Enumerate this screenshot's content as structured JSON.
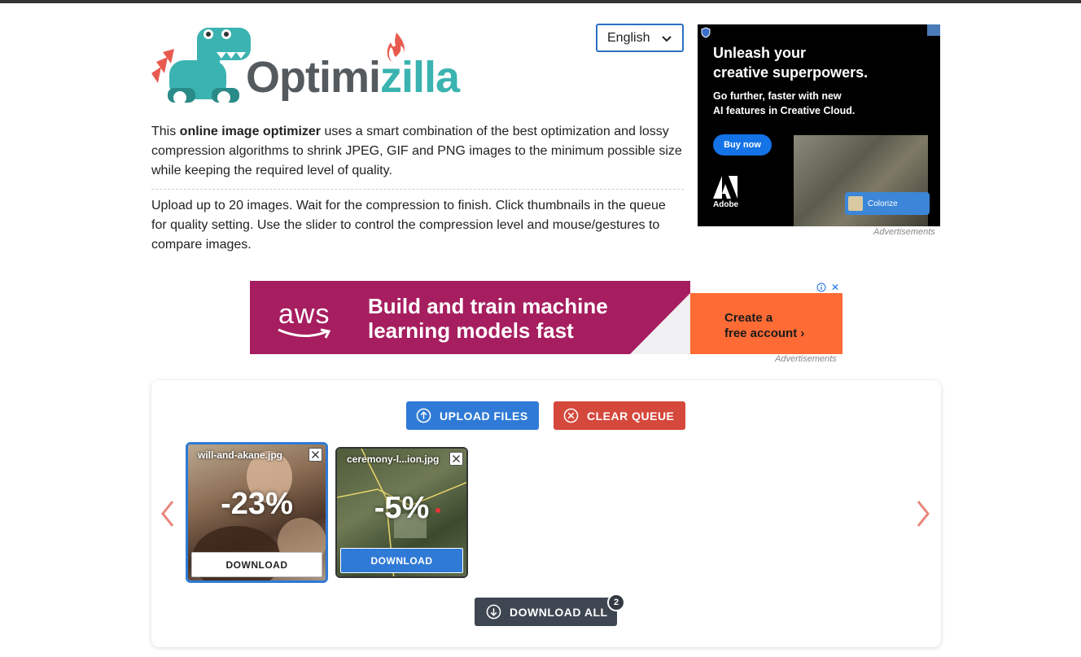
{
  "logo": {
    "word_start": "Optimi",
    "word_end": "zilla"
  },
  "language": {
    "selected": "English"
  },
  "intro": {
    "p1_before": "This ",
    "p1_bold": "online image optimizer",
    "p1_after": " uses a smart combination of the best optimization and lossy compression algorithms to shrink JPEG, GIF and PNG images to the minimum possible size while keeping the required level of quality.",
    "p2": "Upload up to 20 images. Wait for the compression to finish. Click thumbnails in the queue for quality setting. Use the slider to control the compression level and mouse/gestures to compare images."
  },
  "side_ad": {
    "headline_1": "Unleash your",
    "headline_2": "creative superpowers.",
    "sub_1": "Go further, faster with new",
    "sub_2": "AI features in Creative Cloud.",
    "button": "Buy now",
    "brand": "Adobe",
    "chip": "Colorize",
    "caption": "Advertisements"
  },
  "banner_ad": {
    "brand": "aws",
    "headline_1": "Build and train machine",
    "headline_2": "learning models fast",
    "cta_1": "Create a",
    "cta_2": "free account ›",
    "close": "✕",
    "caption": "Advertisements"
  },
  "queue": {
    "upload_label": "UPLOAD FILES",
    "clear_label": "CLEAR QUEUE",
    "items": [
      {
        "name": "will-and-akane.jpg",
        "percent": "-23%",
        "download": "DOWNLOAD"
      },
      {
        "name": "ceremony-l...ion.jpg",
        "percent": "-5%",
        "download": "DOWNLOAD"
      }
    ],
    "download_all_label": "DOWNLOAD ALL",
    "count": "2"
  },
  "colors": {
    "primary": "#2f7ad6",
    "danger": "#d5483c",
    "dark": "#3e4651",
    "arrow": "#e8857a",
    "brand_teal": "#3bb3b0",
    "brand_red": "#e85a4f"
  }
}
